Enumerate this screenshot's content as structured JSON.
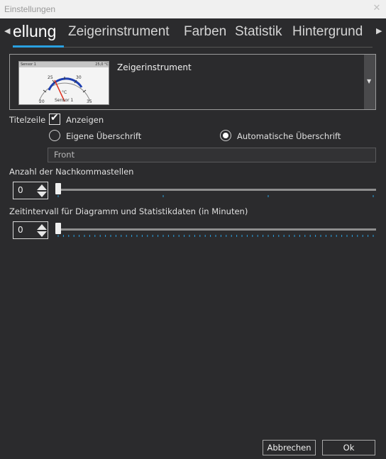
{
  "window": {
    "title": "Einstellungen"
  },
  "tabs": [
    {
      "label": "ellung"
    },
    {
      "label": "Zeigerinstrument"
    },
    {
      "label": "Farben"
    },
    {
      "label": "Statistik"
    },
    {
      "label": "Hintergrund"
    }
  ],
  "gauge_select": {
    "label": "Zeigerinstrument",
    "preview": {
      "sensor": "Sensor 1",
      "value": "25,0 °C",
      "unit": "°C",
      "footer": "Sensor 1",
      "scale": [
        "20",
        "25",
        "30",
        "35"
      ]
    }
  },
  "titlezeile": {
    "label": "Titelzeile",
    "checkbox_label": "Anzeigen",
    "checked": true,
    "radio_own": "Eigene Überschrift",
    "radio_auto": "Automatische Überschrift",
    "selected": "auto",
    "input_value": "Front"
  },
  "decimals": {
    "label": "Anzahl der Nachkommastellen",
    "value": "0"
  },
  "interval": {
    "label": "Zeitintervall für Diagramm und Statistikdaten (in Minuten)",
    "value": "0"
  },
  "buttons": {
    "cancel": "Abbrechen",
    "ok": "Ok"
  },
  "colors": {
    "accent": "#2aa0e0",
    "background": "#2b2b2d",
    "needle": "#e03020",
    "arc": "#1e3fb0"
  }
}
